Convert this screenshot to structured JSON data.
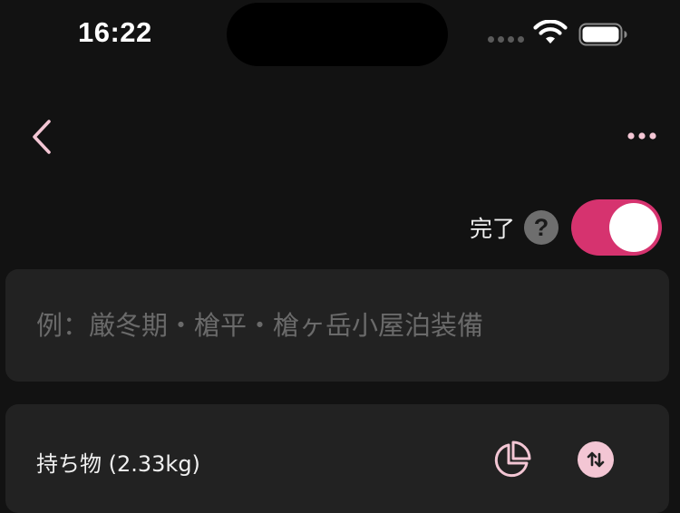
{
  "status_bar": {
    "time": "16:22"
  },
  "nav": {
    "back_icon": "chevron-left-icon",
    "more_icon": "ellipsis-icon"
  },
  "complete": {
    "label": "完了",
    "help_symbol": "?",
    "toggle_on": true
  },
  "name_input": {
    "value": "",
    "placeholder": "例：厳冬期・槍平・槍ヶ岳小屋泊装備"
  },
  "items": {
    "title": "持ち物 (2.33kg)",
    "pie_icon": "pie-chart-icon",
    "sort_icon": "sort-arrows-icon"
  },
  "colors": {
    "accent": "#d6336f",
    "accent_light": "#f3c6d4",
    "background": "#121212",
    "card": "#222222"
  }
}
